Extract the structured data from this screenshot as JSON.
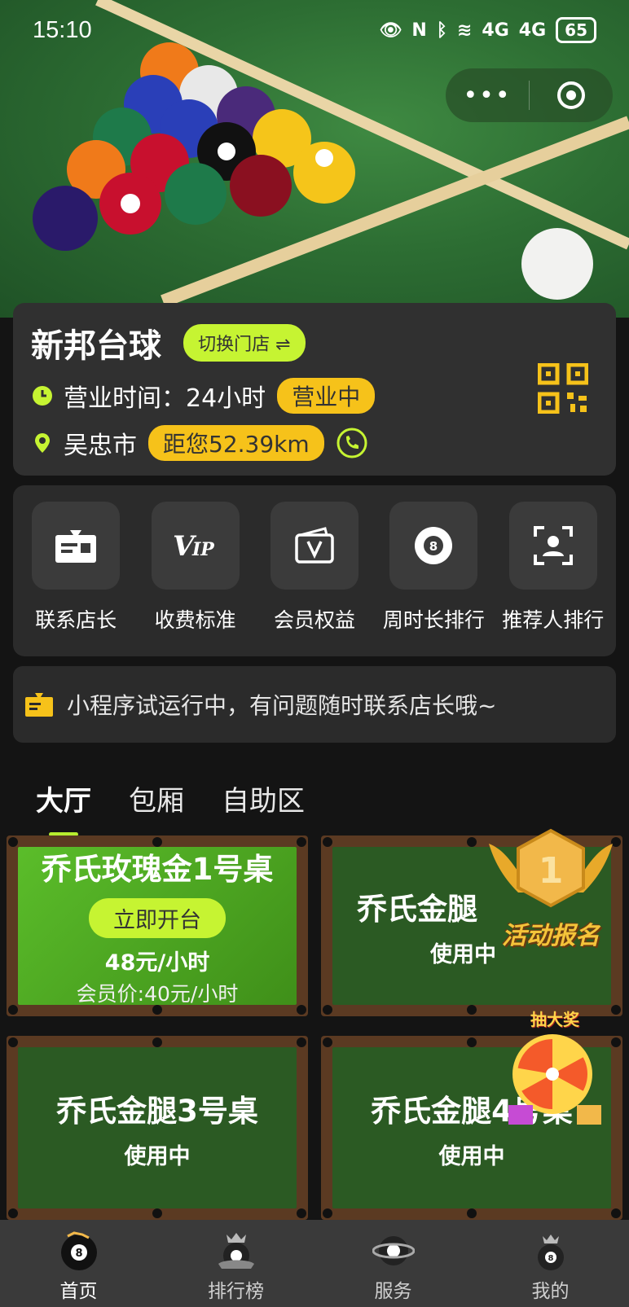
{
  "status_bar": {
    "time": "15:10",
    "network1": "4G",
    "network2": "4G",
    "battery": "65"
  },
  "store": {
    "name": "新邦台球",
    "switch_label": "切换门店 ⇌",
    "hours_label": "营业时间：24小时",
    "open_status": "营业中",
    "city": "吴忠市",
    "distance": "距您52.39km"
  },
  "menu": [
    {
      "label": "联系店长",
      "icon": "card-icon"
    },
    {
      "label": "收费标准",
      "icon": "vip-icon"
    },
    {
      "label": "会员权益",
      "icon": "wallet-icon"
    },
    {
      "label": "周时长排行",
      "icon": "eight-ball-icon"
    },
    {
      "label": "推荐人排行",
      "icon": "person-scan-icon"
    }
  ],
  "notice": "小程序试运行中，有问题随时联系店长哦~",
  "tabs": [
    "大厅",
    "包厢",
    "自助区"
  ],
  "tables": [
    {
      "name": "乔氏玫瑰金1号桌",
      "action": "立即开台",
      "price": "48元/小时",
      "member_price": "会员价:40元/小时"
    },
    {
      "name": "乔氏金腿",
      "status": "使用中"
    },
    {
      "name": "乔氏金腿3号桌",
      "status": "使用中"
    },
    {
      "name": "乔氏金腿4号桌",
      "status": "使用中"
    }
  ],
  "floats": {
    "signup": "活动报名",
    "lottery": "抽大奖"
  },
  "bottom_nav": [
    "首页",
    "排行榜",
    "服务",
    "我的"
  ],
  "colors": {
    "accent": "#c6f432",
    "badge": "#f6c21a",
    "card": "#303030",
    "background": "#141414"
  }
}
